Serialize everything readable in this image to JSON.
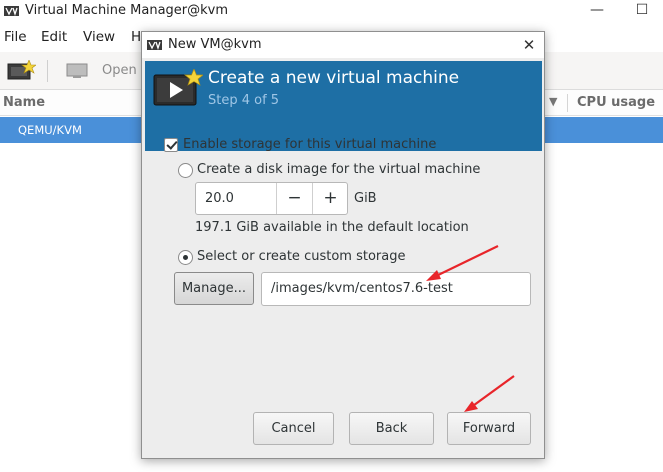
{
  "main_window": {
    "title": "Virtual Machine Manager@kvm",
    "window_controls": {
      "minimize": "—",
      "maximize": "☐"
    },
    "menu": [
      "File",
      "Edit",
      "View",
      "H"
    ],
    "toolbar": {
      "open_label": "Open"
    },
    "columns": {
      "name": "Name",
      "cpu_usage": "CPU usage"
    },
    "rows": [
      {
        "label": "QEMU/KVM",
        "selected": true
      }
    ]
  },
  "dialog": {
    "title": "New VM@kvm",
    "close_glyph": "✕",
    "header": {
      "title": "Create a new virtual machine",
      "step": "Step 4 of 5"
    },
    "enable_storage": {
      "label": "Enable storage for this virtual machine",
      "checked": true
    },
    "create_disk": {
      "label": "Create a disk image for the virtual machine",
      "selected": false,
      "size_value": "20.0",
      "unit": "GiB",
      "available_text": "197.1 GiB available in the default location"
    },
    "custom_storage": {
      "label": "Select or create custom storage",
      "selected": true,
      "manage_label": "Manage...",
      "path_value": "/images/kvm/centos7.6-test"
    },
    "buttons": {
      "cancel": "Cancel",
      "back": "Back",
      "forward": "Forward"
    }
  },
  "colors": {
    "header_blue": "#1e6fa5",
    "selection_blue": "#4a90d9",
    "annotation_arrow": "#e8252a"
  }
}
